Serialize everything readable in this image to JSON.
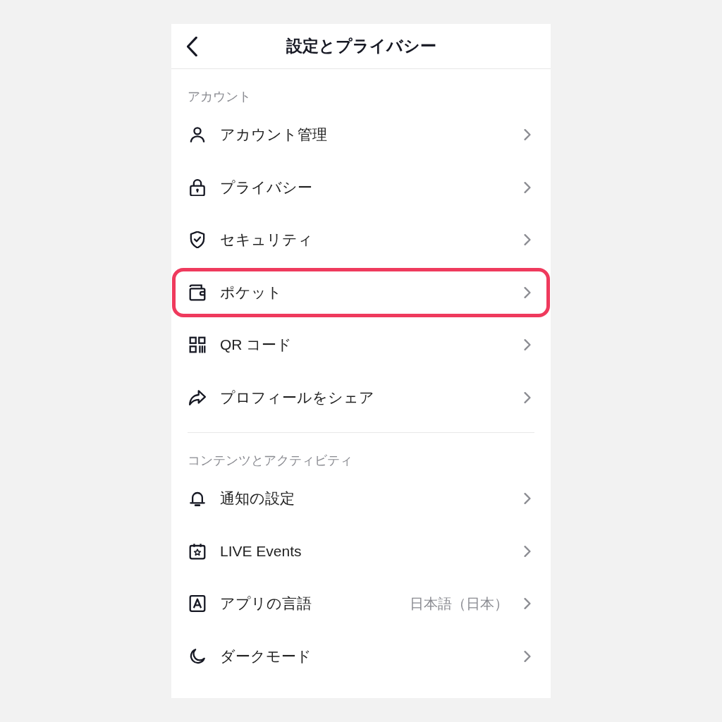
{
  "header": {
    "title": "設定とプライバシー"
  },
  "sections": [
    {
      "heading": "アカウント",
      "items": [
        {
          "label": "アカウント管理",
          "highlighted": false
        },
        {
          "label": "プライバシー",
          "highlighted": false
        },
        {
          "label": "セキュリティ",
          "highlighted": false
        },
        {
          "label": "ポケット",
          "highlighted": true
        },
        {
          "label": "QR コード",
          "highlighted": false
        },
        {
          "label": "プロフィールをシェア",
          "highlighted": false
        }
      ]
    },
    {
      "heading": "コンテンツとアクティビティ",
      "items": [
        {
          "label": "通知の設定",
          "highlighted": false
        },
        {
          "label": "LIVE Events",
          "highlighted": false
        },
        {
          "label": "アプリの言語",
          "value": "日本語（日本）",
          "highlighted": false
        },
        {
          "label": "ダークモード",
          "highlighted": false
        }
      ]
    }
  ]
}
